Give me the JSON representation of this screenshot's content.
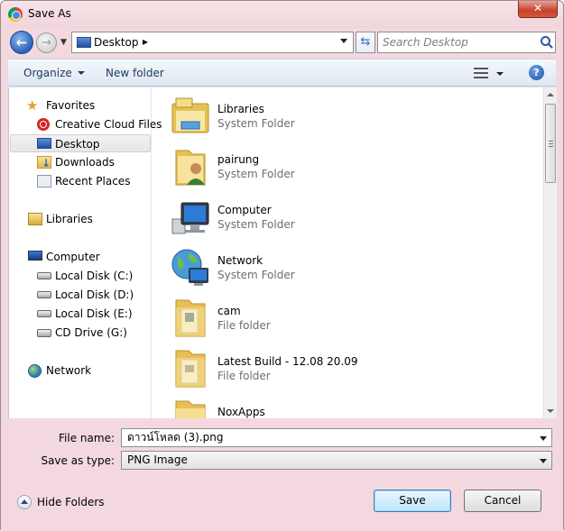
{
  "window": {
    "title": "Save As",
    "close_glyph": "✕"
  },
  "nav": {
    "back_glyph": "←",
    "forward_glyph": "→",
    "address": "Desktop",
    "address_chevron": "▸",
    "refresh_glyph": "⇆",
    "search_placeholder": "Search Desktop"
  },
  "toolbar": {
    "organize_label": "Organize",
    "new_folder_label": "New folder",
    "help_glyph": "?"
  },
  "sidebar": {
    "favorites": "Favorites",
    "creative_cloud": "Creative Cloud Files",
    "desktop": "Desktop",
    "downloads": "Downloads",
    "recent_places": "Recent Places",
    "libraries": "Libraries",
    "computer": "Computer",
    "disk_c": "Local Disk (C:)",
    "disk_d": "Local Disk (D:)",
    "disk_e": "Local Disk (E:)",
    "cd_drive": "CD Drive (G:)",
    "network": "Network",
    "star_glyph": "★"
  },
  "files": [
    {
      "name": "Libraries",
      "type": "System Folder",
      "icon": "libraries-icon"
    },
    {
      "name": "pairung",
      "type": "System Folder",
      "icon": "user-folder-icon"
    },
    {
      "name": "Computer",
      "type": "System Folder",
      "icon": "computer-icon"
    },
    {
      "name": "Network",
      "type": "System Folder",
      "icon": "network-icon"
    },
    {
      "name": "cam",
      "type": "File folder",
      "icon": "folder-icon"
    },
    {
      "name": "Latest Build - 12.08 20.09",
      "type": "File folder",
      "icon": "folder-icon"
    },
    {
      "name": "NoxApps",
      "type": "",
      "icon": "folder-icon"
    }
  ],
  "form": {
    "file_name_label": "File name:",
    "file_name_value": "ดาวน์โหลด (3).png",
    "save_type_label": "Save as type:",
    "save_type_value": "PNG Image"
  },
  "footer": {
    "hide_folders_label": "Hide Folders",
    "save_label": "Save",
    "cancel_label": "Cancel"
  }
}
